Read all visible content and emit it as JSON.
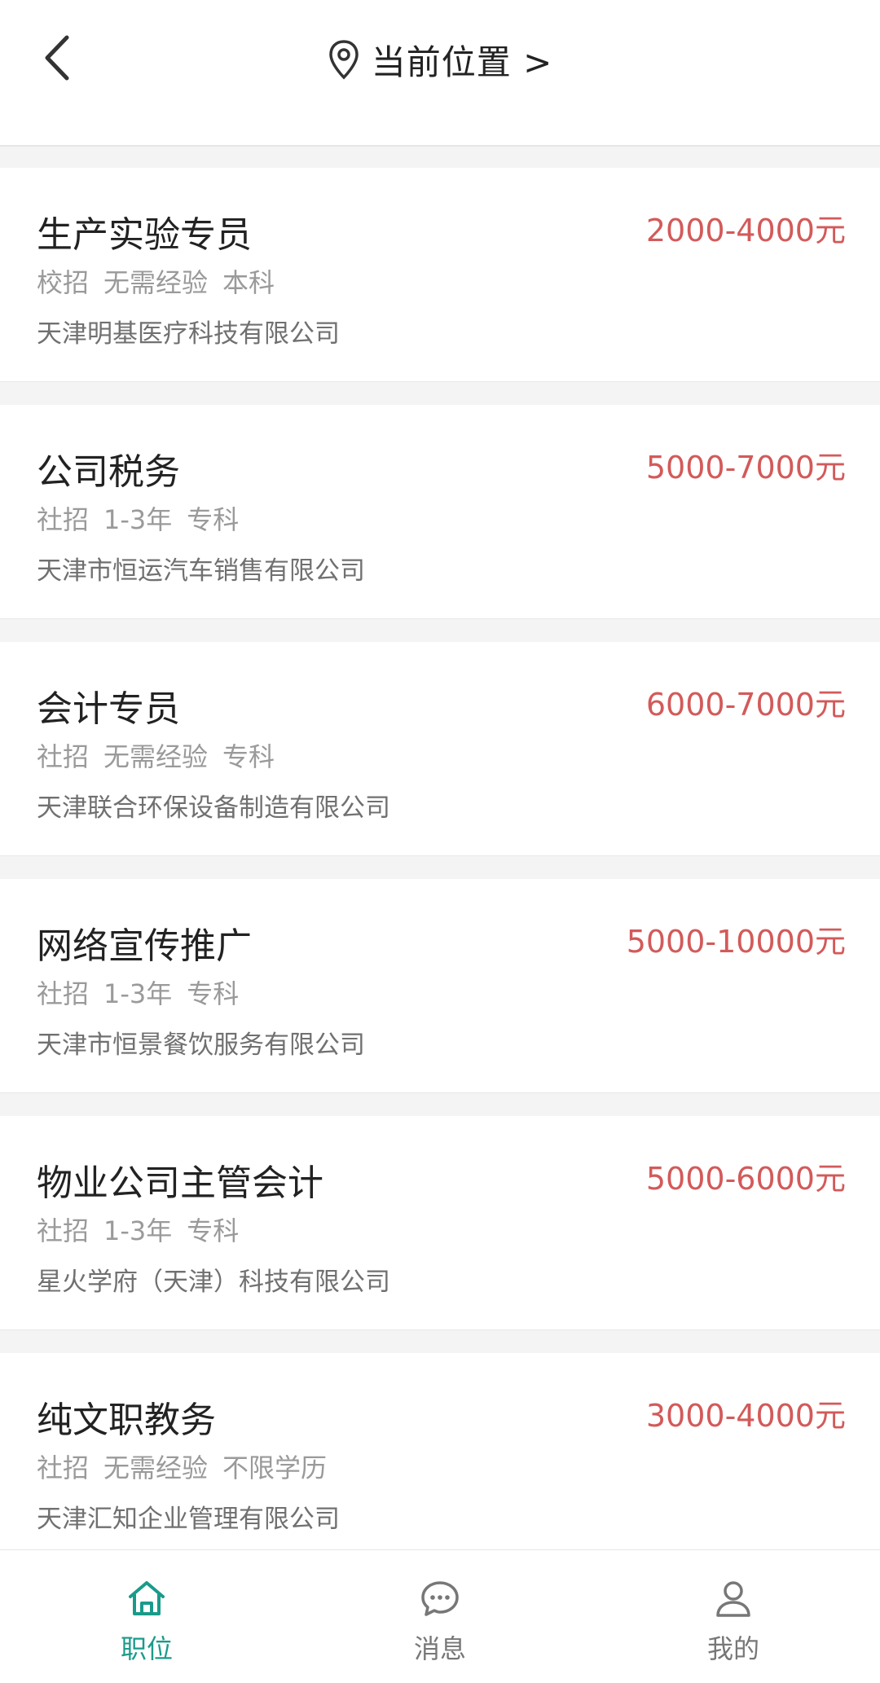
{
  "header": {
    "location_label": "当前位置 >"
  },
  "jobs": [
    {
      "title": "生产实验专员",
      "salary": "2000-4000元",
      "tags": [
        "校招",
        "无需经验",
        "本科"
      ],
      "company": "天津明基医疗科技有限公司"
    },
    {
      "title": "公司税务",
      "salary": "5000-7000元",
      "tags": [
        "社招",
        "1-3年",
        "专科"
      ],
      "company": "天津市恒运汽车销售有限公司"
    },
    {
      "title": "会计专员",
      "salary": "6000-7000元",
      "tags": [
        "社招",
        "无需经验",
        "专科"
      ],
      "company": "天津联合环保设备制造有限公司"
    },
    {
      "title": "网络宣传推广",
      "salary": "5000-10000元",
      "tags": [
        "社招",
        "1-3年",
        "专科"
      ],
      "company": "天津市恒景餐饮服务有限公司"
    },
    {
      "title": "物业公司主管会计",
      "salary": "5000-6000元",
      "tags": [
        "社招",
        "1-3年",
        "专科"
      ],
      "company": "星火学府（天津）科技有限公司"
    },
    {
      "title": "纯文职教务",
      "salary": "3000-4000元",
      "tags": [
        "社招",
        "无需经验",
        "不限学历"
      ],
      "company": "天津汇知企业管理有限公司"
    }
  ],
  "tabbar": {
    "items": [
      {
        "label": "职位",
        "icon": "home-icon",
        "active": true
      },
      {
        "label": "消息",
        "icon": "chat-bubble-icon",
        "active": false
      },
      {
        "label": "我的",
        "icon": "user-icon",
        "active": false
      }
    ]
  },
  "colors": {
    "accent": "#1a9b8a",
    "salary": "#d35a5a"
  }
}
